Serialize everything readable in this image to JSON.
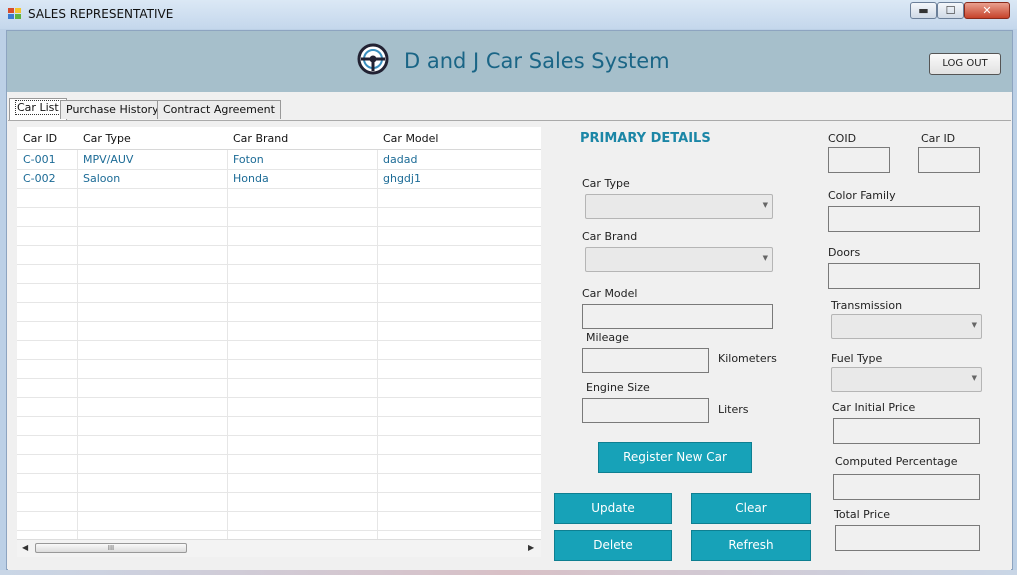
{
  "window": {
    "title": "SALES REPRESENTATIVE",
    "minimize": "▬",
    "maximize": "☐",
    "close": "✕"
  },
  "header": {
    "app_title": "D and J Car Sales System",
    "logout_label": "LOG OUT",
    "logo_icon": "steering-wheel-icon"
  },
  "tabs": [
    {
      "label": "Car List",
      "active": true
    },
    {
      "label": "Purchase History",
      "active": false
    },
    {
      "label": "Contract Agreement",
      "active": false
    }
  ],
  "grid": {
    "columns": [
      "Car ID",
      "Car Type",
      "Car Brand",
      "Car Model"
    ],
    "rows": [
      [
        "C-001",
        "MPV/AUV",
        "Foton",
        "dadad"
      ],
      [
        "C-002",
        "Saloon",
        "Honda",
        "ghgdj1"
      ]
    ],
    "scroll_thumb": "III"
  },
  "primary": {
    "title": "PRIMARY DETAILS",
    "car_type_label": "Car Type",
    "car_brand_label": "Car Brand",
    "car_model_label": "Car Model",
    "mileage_label": "Mileage",
    "mileage_unit": "Kilometers",
    "engine_label": "Engine Size",
    "engine_unit": "Liters"
  },
  "details": {
    "coid_label": "COID",
    "car_id_label": "Car ID",
    "color_label": "Color Family",
    "doors_label": "Doors",
    "transmission_label": "Transmission",
    "fuel_label": "Fuel Type",
    "initial_price_label": "Car Initial Price",
    "computed_label": "Computed Percentage",
    "total_label": "Total Price"
  },
  "buttons": {
    "register": "Register New Car",
    "update": "Update",
    "clear": "Clear",
    "delete": "Delete",
    "refresh": "Refresh"
  },
  "colors": {
    "accent": "#17a2b8",
    "header_bg": "#a6bfcb",
    "title_text": "#1a6586",
    "section_title": "#1b86a6"
  }
}
